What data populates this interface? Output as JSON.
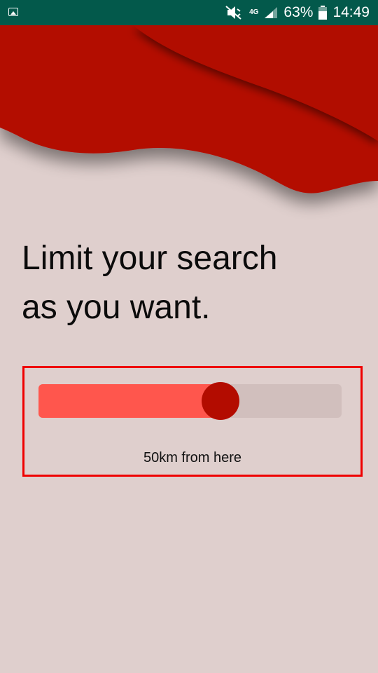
{
  "status_bar": {
    "network": "4G",
    "battery_percent": "63%",
    "time": "14:49",
    "icons": [
      "image-icon",
      "mute-icon",
      "signal-icon",
      "battery-icon"
    ]
  },
  "colors": {
    "status_bar": "#03594b",
    "background": "#dfcfcd",
    "header_red": "#b30c00",
    "slider_fill": "#ff564d",
    "slider_track": "#d1bfbd",
    "slider_thumb": "#b30c00",
    "highlight_border": "#ef0000"
  },
  "main": {
    "title_line1": "Limit your search",
    "title_line2": "as you want."
  },
  "distance_slider": {
    "fraction": 0.6,
    "caption": "50km from here"
  }
}
